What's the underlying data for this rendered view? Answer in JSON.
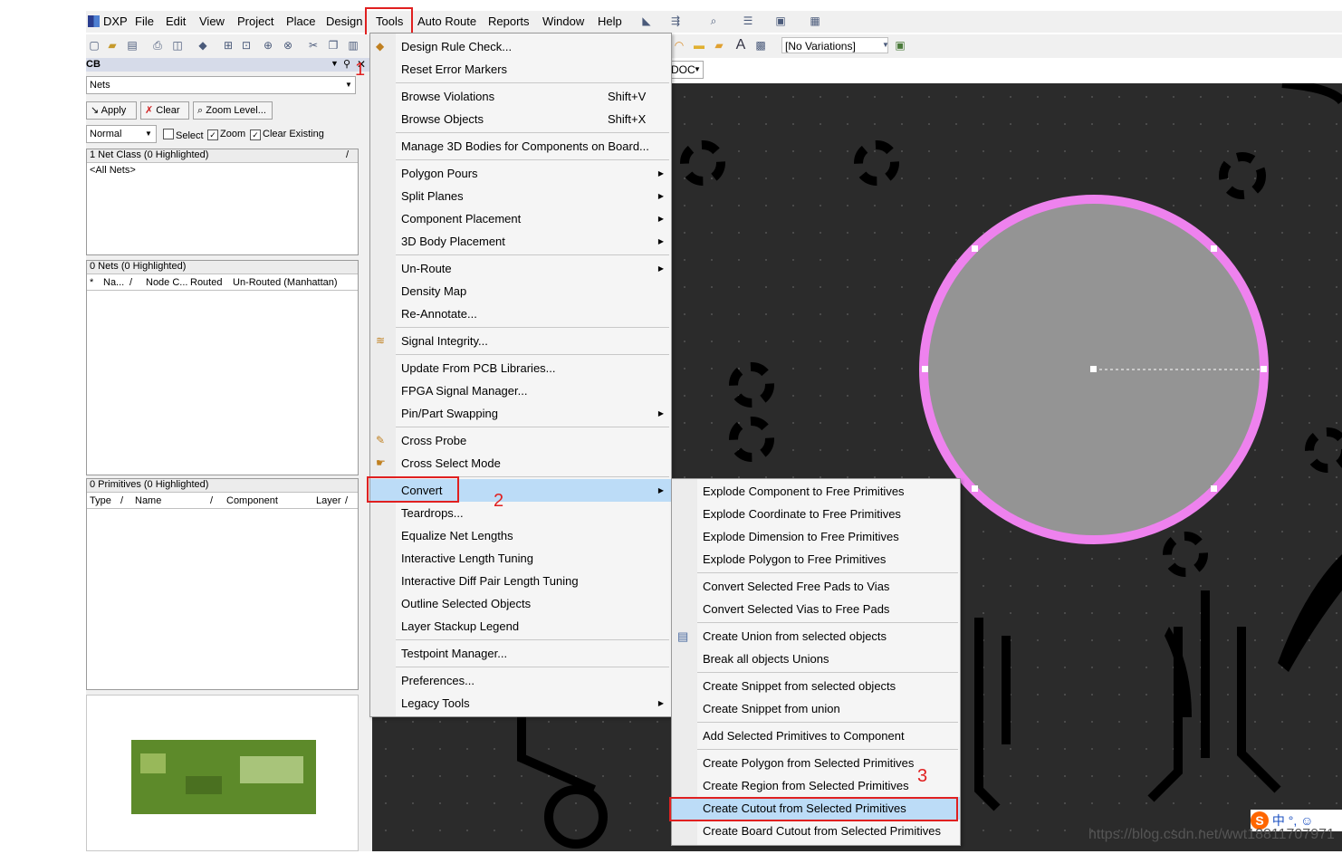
{
  "menubar": {
    "items": [
      "DXP",
      "File",
      "Edit",
      "View",
      "Project",
      "Place",
      "Design",
      "Tools",
      "Auto Route",
      "Reports",
      "Window",
      "Help"
    ]
  },
  "toolbar": {
    "variations": "[No Variations]",
    "doc_combo": "DOC"
  },
  "panel": {
    "title": "CB",
    "filter_value": "Nets",
    "apply_label": "Apply",
    "clear_label": "Clear",
    "zoom_level_label": "Zoom Level...",
    "mode_value": "Normal",
    "select_label": "Select",
    "zoom_label": "Zoom",
    "clear_existing_label": "Clear Existing",
    "netclass_header": "1 Net Class (0 Highlighted)",
    "netclass_item": "<All Nets>",
    "nets_header": "0 Nets (0 Highlighted)",
    "nets_columns": [
      "*",
      "Na...",
      "Node C...",
      "Routed",
      "Un-Routed (Manhattan)"
    ],
    "prims_header": "0 Primitives (0 Highlighted)",
    "prims_columns": [
      "Type",
      "Name",
      "Component",
      "Layer"
    ]
  },
  "tools_menu": {
    "items": [
      {
        "label": "Design Rule Check...",
        "shortcut": "",
        "submenu": false
      },
      {
        "label": "Reset Error Markers",
        "shortcut": "",
        "submenu": false
      },
      {
        "label": "Browse Violations",
        "shortcut": "Shift+V",
        "submenu": false
      },
      {
        "label": "Browse Objects",
        "shortcut": "Shift+X",
        "submenu": false
      },
      {
        "label": "Manage 3D Bodies for Components on Board...",
        "shortcut": "",
        "submenu": false
      },
      {
        "label": "Polygon Pours",
        "shortcut": "",
        "submenu": true
      },
      {
        "label": "Split Planes",
        "shortcut": "",
        "submenu": true
      },
      {
        "label": "Component Placement",
        "shortcut": "",
        "submenu": true
      },
      {
        "label": "3D Body Placement",
        "shortcut": "",
        "submenu": true
      },
      {
        "label": "Un-Route",
        "shortcut": "",
        "submenu": true
      },
      {
        "label": "Density Map",
        "shortcut": "",
        "submenu": false
      },
      {
        "label": "Re-Annotate...",
        "shortcut": "",
        "submenu": false
      },
      {
        "label": "Signal Integrity...",
        "shortcut": "",
        "submenu": false
      },
      {
        "label": "Update From PCB Libraries...",
        "shortcut": "",
        "submenu": false
      },
      {
        "label": "FPGA Signal Manager...",
        "shortcut": "",
        "submenu": false
      },
      {
        "label": "Pin/Part Swapping",
        "shortcut": "",
        "submenu": true
      },
      {
        "label": "Cross Probe",
        "shortcut": "",
        "submenu": false
      },
      {
        "label": "Cross Select Mode",
        "shortcut": "",
        "submenu": false
      },
      {
        "label": "Convert",
        "shortcut": "",
        "submenu": true
      },
      {
        "label": "Teardrops...",
        "shortcut": "",
        "submenu": false
      },
      {
        "label": "Equalize Net Lengths",
        "shortcut": "",
        "submenu": false
      },
      {
        "label": "Interactive Length Tuning",
        "shortcut": "",
        "submenu": false
      },
      {
        "label": "Interactive Diff Pair Length Tuning",
        "shortcut": "",
        "submenu": false
      },
      {
        "label": "Outline Selected Objects",
        "shortcut": "",
        "submenu": false
      },
      {
        "label": "Layer Stackup Legend",
        "shortcut": "",
        "submenu": false
      },
      {
        "label": "Testpoint Manager...",
        "shortcut": "",
        "submenu": false
      },
      {
        "label": "Preferences...",
        "shortcut": "",
        "submenu": false
      },
      {
        "label": "Legacy Tools",
        "shortcut": "",
        "submenu": true
      }
    ]
  },
  "convert_menu": {
    "items": [
      "Explode Component to Free Primitives",
      "Explode Coordinate to Free Primitives",
      "Explode Dimension to Free Primitives",
      "Explode Polygon to Free Primitives",
      "Convert Selected Free Pads to Vias",
      "Convert Selected Vias to Free Pads",
      "Create Union from selected objects",
      "Break all objects Unions",
      "Create Snippet from selected objects",
      "Create Snippet from union",
      "Add Selected Primitives to Component",
      "Create Polygon from Selected Primitives",
      "Create Region from Selected Primitives",
      "Create Cutout from Selected Primitives",
      "Create Board Cutout from Selected Primitives"
    ]
  },
  "annotations": [
    "1",
    "2",
    "3"
  ],
  "watermark": "https://blog.csdn.net/wwt18811707971",
  "ime": "中 °, ☺",
  "colors": {
    "highlight": "#bcdcf7",
    "annotation": "#e02020",
    "board_outline": "#ee82ee",
    "canvas": "#2b2b2b"
  }
}
